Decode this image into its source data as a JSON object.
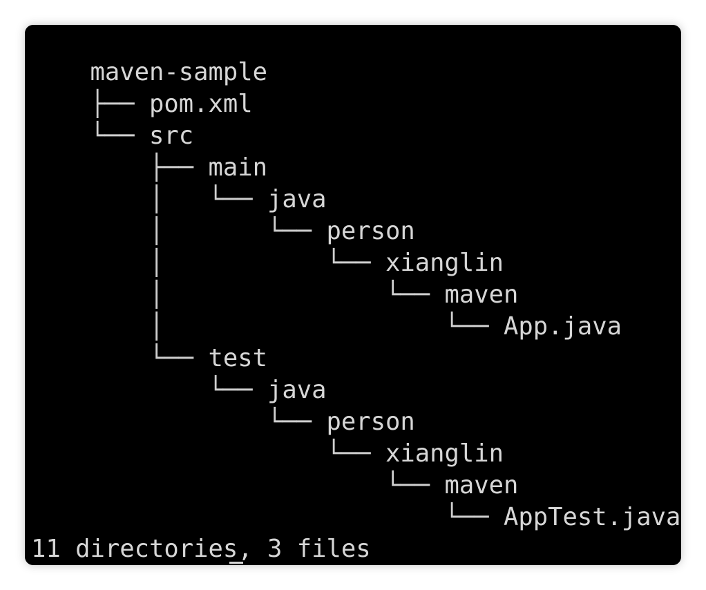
{
  "terminal": {
    "lines": [
      {
        "prefix": "",
        "name": "maven-sample"
      },
      {
        "prefix": "├── ",
        "name": "pom.xml"
      },
      {
        "prefix": "└── ",
        "name": "src"
      },
      {
        "prefix": "    ├── ",
        "name": "main"
      },
      {
        "prefix": "    │   └── ",
        "name": "java"
      },
      {
        "prefix": "    │       └── ",
        "name": "person"
      },
      {
        "prefix": "    │           └── ",
        "name": "xianglin"
      },
      {
        "prefix": "    │               └── ",
        "name": "maven"
      },
      {
        "prefix": "    │                   └── ",
        "name": "App.java"
      },
      {
        "prefix": "    └── ",
        "name": "test"
      },
      {
        "prefix": "        └── ",
        "name": "java"
      },
      {
        "prefix": "            └── ",
        "name": "person"
      },
      {
        "prefix": "                └── ",
        "name": "xianglin"
      },
      {
        "prefix": "                    └── ",
        "name": "maven"
      },
      {
        "prefix": "                        └── ",
        "name": "AppTest.java"
      }
    ],
    "summary": "11 directories, 3 files"
  }
}
